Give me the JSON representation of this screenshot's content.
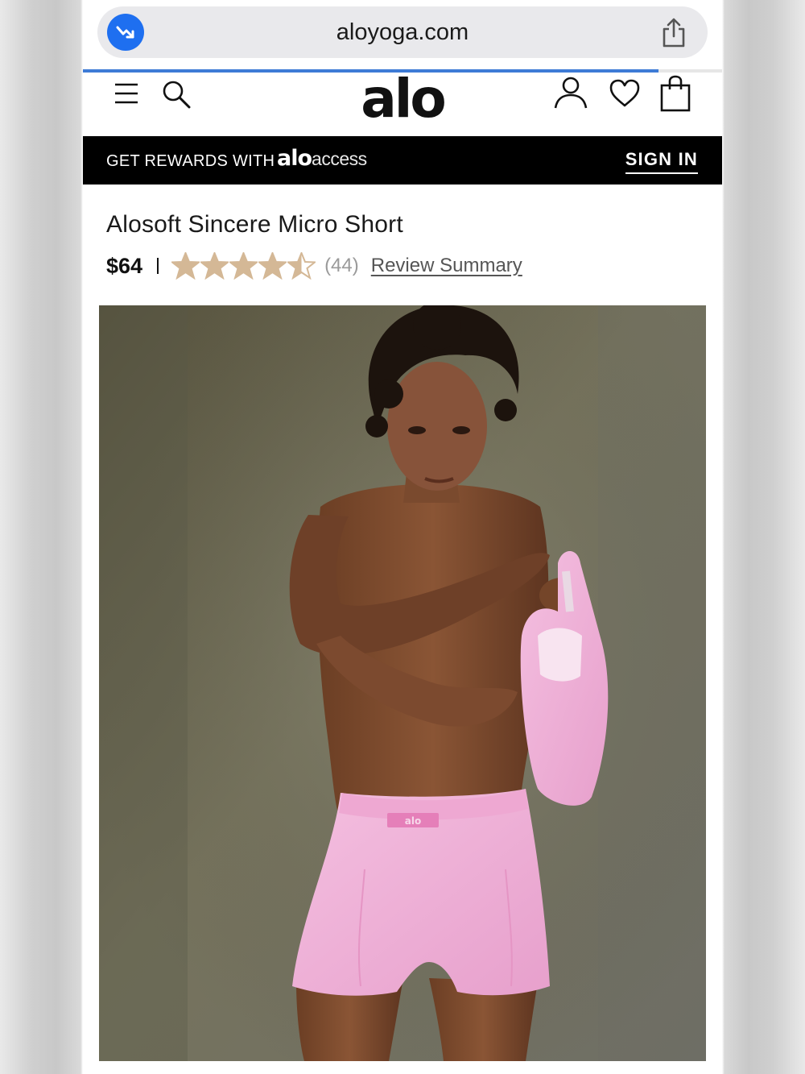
{
  "browser": {
    "url": "aloyoga.com",
    "load_progress": 0.9
  },
  "site": {
    "logo": "alo",
    "icons": [
      "menu-icon",
      "search-icon",
      "account-icon",
      "heart-icon",
      "bag-icon"
    ]
  },
  "rewards_bar": {
    "text": "GET REWARDS WITH",
    "brand_bold": "alo",
    "brand_light": "access",
    "sign_in": "SIGN IN"
  },
  "product": {
    "title": "Alosoft Sincere Micro Short",
    "price": "$64",
    "rating": 4.5,
    "rating_max": 5,
    "review_count": "(44)",
    "review_link": "Review Summary"
  },
  "photo": {
    "logo_tag": "alo"
  },
  "colors": {
    "star": "#d4b896",
    "badge_blue": "#1e6ff0",
    "progress": "#3d7bd6",
    "short_pink": "#f0aed6"
  }
}
